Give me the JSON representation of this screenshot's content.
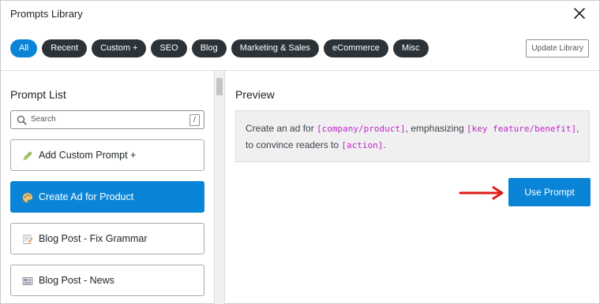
{
  "header": {
    "title": "Prompts Library"
  },
  "tabs": [
    {
      "label": "All"
    },
    {
      "label": "Recent"
    },
    {
      "label": "Custom +"
    },
    {
      "label": "SEO"
    },
    {
      "label": "Blog"
    },
    {
      "label": "Marketing & Sales"
    },
    {
      "label": "eCommerce"
    },
    {
      "label": "Misc"
    }
  ],
  "active_tab": "All",
  "update_button": "Update Library",
  "prompt_list": {
    "title": "Prompt List",
    "search_placeholder": "Search",
    "search_shortcut": "/",
    "items": [
      {
        "label": "Add Custom Prompt +",
        "icon": "pencil-icon"
      },
      {
        "label": "Create Ad for Product",
        "icon": "palette-icon"
      },
      {
        "label": "Blog Post - Fix Grammar",
        "icon": "memo-icon"
      },
      {
        "label": "Blog Post - News",
        "icon": "newspaper-icon"
      }
    ],
    "selected_index": 1
  },
  "preview": {
    "title": "Preview",
    "segments": [
      {
        "text": "Create an ad for ",
        "code": false
      },
      {
        "text": "[company/product]",
        "code": true
      },
      {
        "text": ", emphasizing ",
        "code": false
      },
      {
        "text": "[key feature/benefit]",
        "code": true
      },
      {
        "text": ", to convince readers to ",
        "code": false
      },
      {
        "text": "[action]",
        "code": true
      },
      {
        "text": ".",
        "code": false
      }
    ]
  },
  "use_button": "Use Prompt",
  "colors": {
    "accent": "#0a84d6",
    "tab_dark": "#2c3338",
    "placeholder_code": "#c026c9",
    "annotation_arrow": "#e01b1b"
  }
}
